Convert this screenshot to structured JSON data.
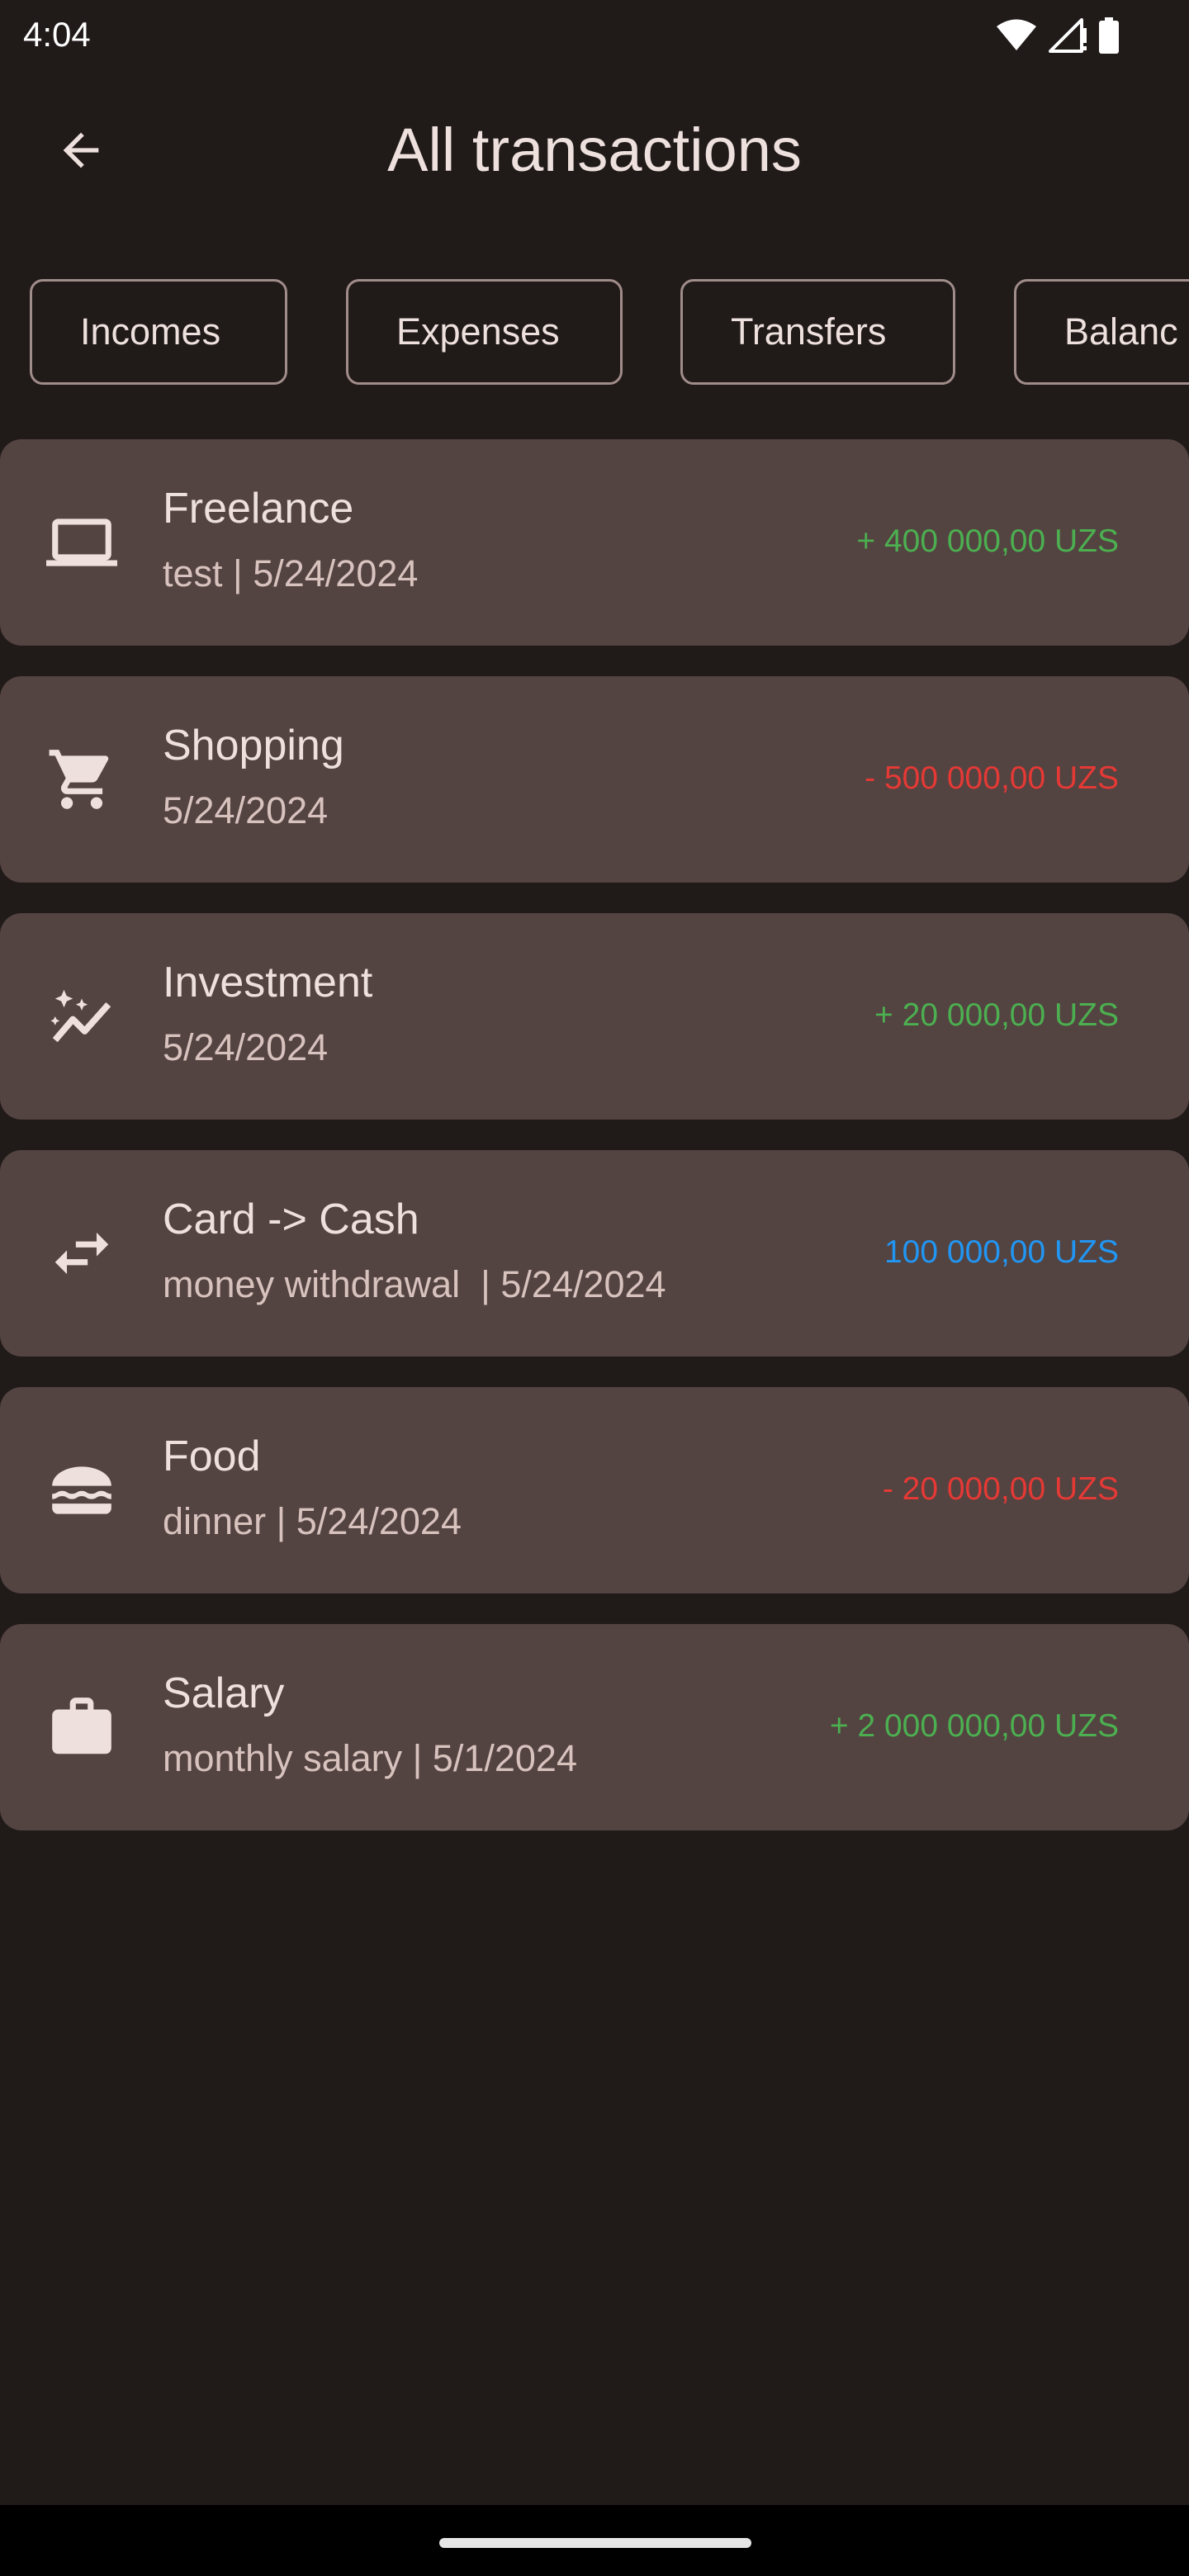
{
  "status_bar": {
    "time": "4:04",
    "icons": [
      "wifi-icon",
      "signal-icon",
      "battery-icon"
    ]
  },
  "app_bar": {
    "back_icon": "arrow-back-icon",
    "title": "All transactions"
  },
  "filters": [
    {
      "label": "Incomes"
    },
    {
      "label": "Expenses"
    },
    {
      "label": "Transfers"
    },
    {
      "label": "Balanc"
    }
  ],
  "colors": {
    "background": "#201a19",
    "card": "#534341",
    "income": "#4caf50",
    "expense": "#e53935",
    "transfer": "#2196f3"
  },
  "transactions": [
    {
      "icon": "laptop-icon",
      "title": "Freelance",
      "subtitle": "test | 5/24/2024",
      "amount": "+ 400 000,00 UZS",
      "kind": "income"
    },
    {
      "icon": "shopping-cart-icon",
      "title": "Shopping",
      "subtitle": "5/24/2024",
      "amount": "- 500 000,00 UZS",
      "kind": "expense"
    },
    {
      "icon": "trending-sparkle-icon",
      "title": "Investment",
      "subtitle": "5/24/2024",
      "amount": "+ 20 000,00 UZS",
      "kind": "income"
    },
    {
      "icon": "swap-arrows-icon",
      "title": "Card -> Cash",
      "subtitle": "money withdrawal  | 5/24/2024",
      "amount": "100 000,00 UZS",
      "kind": "transfer"
    },
    {
      "icon": "burger-icon",
      "title": "Food",
      "subtitle": "dinner | 5/24/2024",
      "amount": "- 20 000,00 UZS",
      "kind": "expense"
    },
    {
      "icon": "briefcase-icon",
      "title": "Salary",
      "subtitle": "monthly salary | 5/1/2024",
      "amount": "+ 2 000 000,00 UZS",
      "kind": "income"
    }
  ]
}
